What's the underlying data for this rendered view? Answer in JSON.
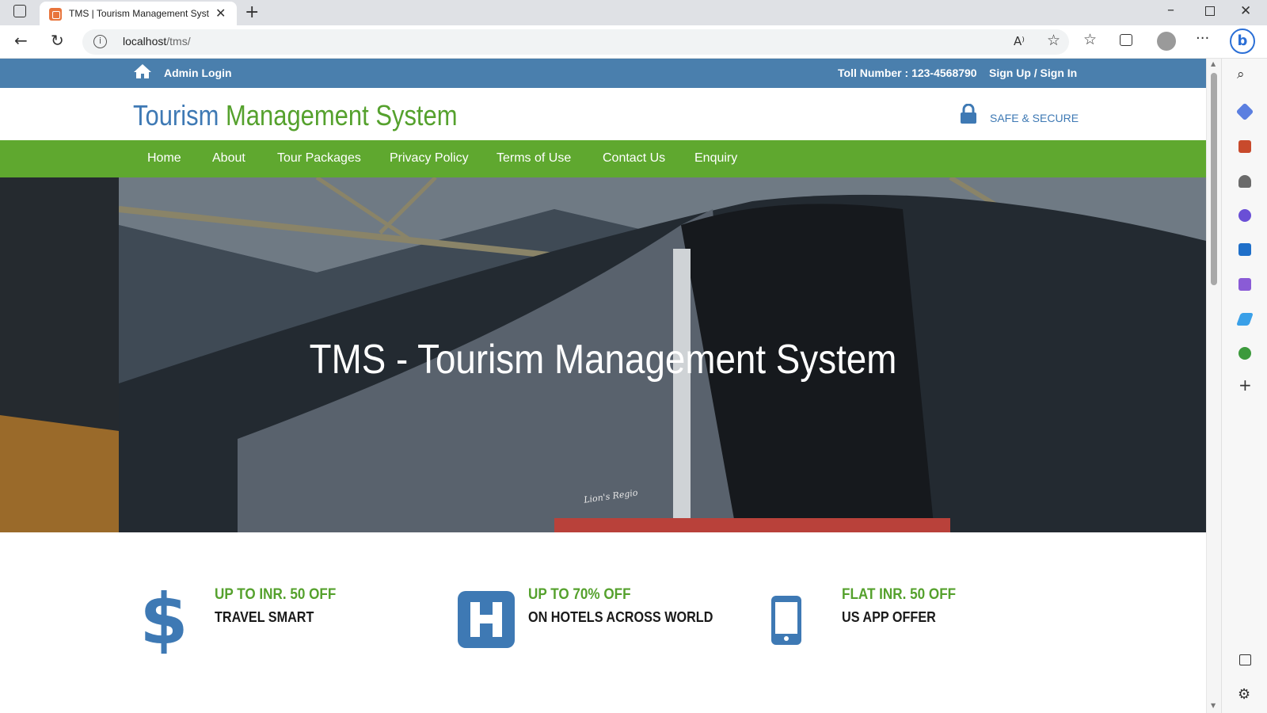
{
  "browser": {
    "tab_title": "TMS | Tourism Management Syst",
    "url_host": "localhost",
    "url_path": "/tms/"
  },
  "topbar": {
    "admin_login": "Admin Login",
    "toll_number": "Toll Number : 123-4568790",
    "sign_up_in": "Sign Up / Sign In"
  },
  "header": {
    "brand_part1": "Tourism",
    "brand_part2": "Management System",
    "secure_label": "SAFE & SECURE"
  },
  "nav": {
    "items": [
      {
        "label": "Home"
      },
      {
        "label": "About"
      },
      {
        "label": "Tour Packages"
      },
      {
        "label": "Privacy Policy"
      },
      {
        "label": "Terms of Use"
      },
      {
        "label": "Contact Us"
      },
      {
        "label": "Enquiry"
      }
    ]
  },
  "hero": {
    "title": "TMS - Tourism Management System",
    "bus_lettering": "Lion's Regio"
  },
  "features": [
    {
      "icon": "dollar-icon",
      "title": "UP TO INR. 50 OFF",
      "subtitle": "TRAVEL SMART"
    },
    {
      "icon": "hotel-icon",
      "title": "UP TO 70% OFF",
      "subtitle": "ON HOTELS ACROSS WORLD"
    },
    {
      "icon": "mobile-icon",
      "title": "FLAT INR. 50 OFF",
      "subtitle": "US APP OFFER"
    }
  ],
  "colors": {
    "topbar_blue": "#4a7fad",
    "nav_green": "#5fa82f",
    "brand_blue": "#3e79b4",
    "brand_green": "#55a12d"
  }
}
